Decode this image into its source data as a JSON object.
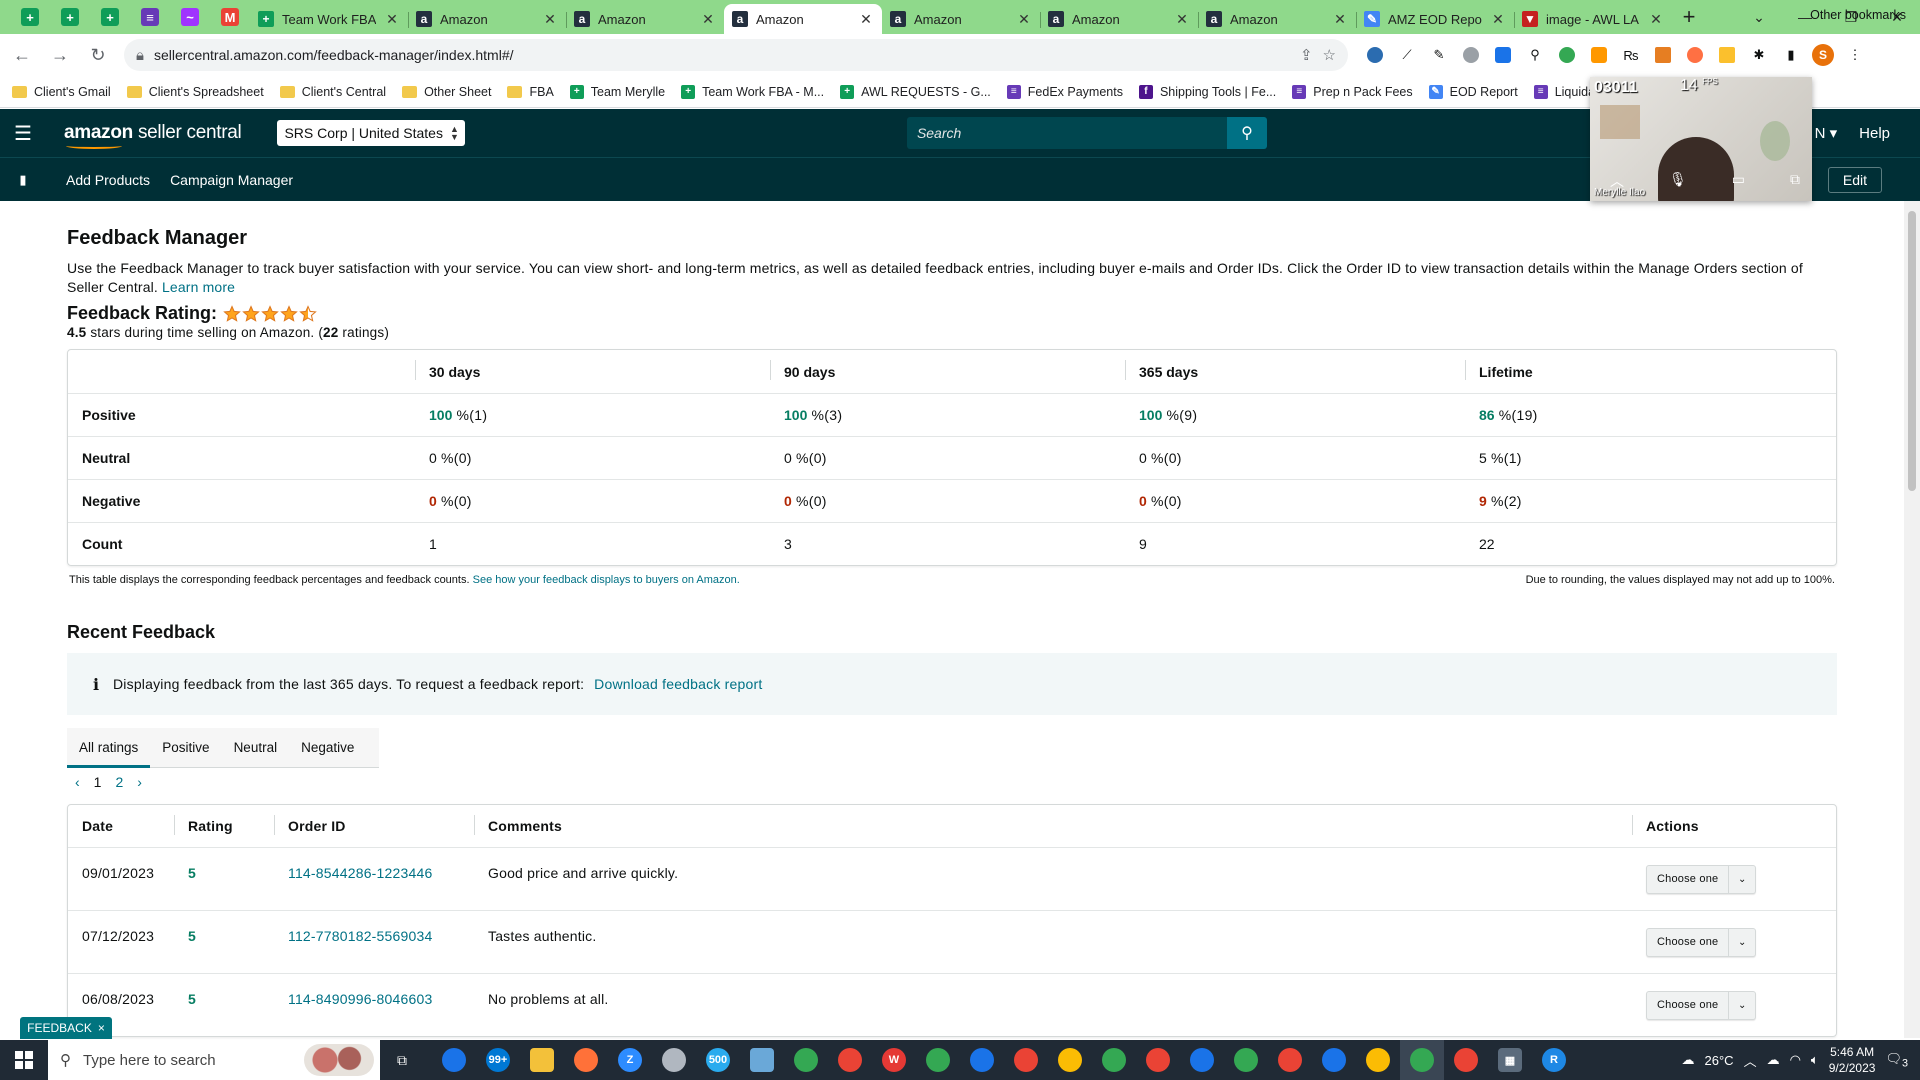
{
  "browser": {
    "pinned_tabs": [
      {
        "icon": "sheets-icon",
        "color": "#0f9d58",
        "glyph": "+"
      },
      {
        "icon": "sheets-icon",
        "color": "#0f9d58",
        "glyph": "+"
      },
      {
        "icon": "sheets-icon",
        "color": "#0f9d58",
        "glyph": "+"
      },
      {
        "icon": "forms-icon",
        "color": "#673ab7",
        "glyph": "≡"
      },
      {
        "icon": "messenger-icon",
        "color": "#a033ff",
        "glyph": "~"
      },
      {
        "icon": "gmail-icon",
        "color": "#ea4335",
        "glyph": "M"
      }
    ],
    "tabs": [
      {
        "title": "Team Work FBA -",
        "icon": "sheets-icon",
        "color": "#0f9d58",
        "glyph": "+",
        "active": false
      },
      {
        "title": "Amazon",
        "icon": "amazon-icon",
        "color": "#232f3e",
        "glyph": "a",
        "active": false
      },
      {
        "title": "Amazon",
        "icon": "amazon-icon",
        "color": "#232f3e",
        "glyph": "a",
        "active": false
      },
      {
        "title": "Amazon",
        "icon": "amazon-icon",
        "color": "#232f3e",
        "glyph": "a",
        "active": true
      },
      {
        "title": "Amazon",
        "icon": "amazon-icon",
        "color": "#232f3e",
        "glyph": "a",
        "active": false
      },
      {
        "title": "Amazon",
        "icon": "amazon-icon",
        "color": "#232f3e",
        "glyph": "a",
        "active": false
      },
      {
        "title": "Amazon",
        "icon": "amazon-icon",
        "color": "#232f3e",
        "glyph": "a",
        "active": false
      },
      {
        "title": "AMZ EOD Report",
        "icon": "pencil-icon",
        "color": "#4285f4",
        "glyph": "✎",
        "active": false
      },
      {
        "title": "image - AWL LAB",
        "icon": "gmail-icon",
        "color": "#c5221f",
        "glyph": "▼",
        "active": false
      }
    ],
    "url": "sellercentral.amazon.com/feedback-manager/index.html#/",
    "profile_initial": "S",
    "bookmarks": [
      {
        "label": "Client's Gmail",
        "type": "folder"
      },
      {
        "label": "Client's Spreadsheet",
        "type": "folder"
      },
      {
        "label": "Client's Central",
        "type": "folder"
      },
      {
        "label": "Other Sheet",
        "type": "folder"
      },
      {
        "label": "FBA",
        "type": "folder"
      },
      {
        "label": "Team Merylle",
        "type": "sheet"
      },
      {
        "label": "Team Work FBA - M...",
        "type": "sheet"
      },
      {
        "label": "AWL REQUESTS - G...",
        "type": "sheet"
      },
      {
        "label": "FedEx Payments",
        "type": "form"
      },
      {
        "label": "Shipping Tools | Fe...",
        "type": "fedex"
      },
      {
        "label": "Prep n Pack Fees",
        "type": "form"
      },
      {
        "label": "EOD Report",
        "type": "pencil"
      },
      {
        "label": "Liquidation Rec",
        "type": "form"
      }
    ],
    "other_bookmarks": "Other bookmarks"
  },
  "header": {
    "logo_brand": "amazon",
    "logo_product": "seller central",
    "account": "SRS Corp | United States",
    "search_placeholder": "Search",
    "lang": "N",
    "help": "Help"
  },
  "subnav": {
    "links": [
      "Add Products",
      "Campaign Manager"
    ],
    "edit": "Edit"
  },
  "video": {
    "label": "03011",
    "fps_value": "14",
    "fps_unit": "FPS",
    "name": "Merylle Ilao"
  },
  "page": {
    "title": "Feedback Manager",
    "intro": "Use the Feedback Manager to track buyer satisfaction with your service. You can view short- and long-term metrics, as well as detailed feedback entries, including buyer e-mails and Order IDs. Click the Order ID to view transaction details within the Manage Orders section of Seller Central.",
    "learn_more": "Learn more",
    "rating_label": "Feedback Rating:",
    "rating_value": 4.5,
    "rating_stars": "4.5",
    "rating_text_mid": "stars during time selling on Amazon. (",
    "rating_count": "22",
    "rating_text_end": "ratings)"
  },
  "metrics": {
    "columns": [
      "",
      "30 days",
      "90 days",
      "365 days",
      "Lifetime"
    ],
    "rows": [
      {
        "label": "Positive",
        "kind": "pos",
        "cells": [
          {
            "v": "100",
            "n": " %(1)"
          },
          {
            "v": "100",
            "n": " %(3)"
          },
          {
            "v": "100",
            "n": " %(9)"
          },
          {
            "v": "86",
            "n": " %(19)"
          }
        ]
      },
      {
        "label": "Neutral",
        "kind": "neu",
        "cells": [
          {
            "v": "0",
            "n": " %(0)"
          },
          {
            "v": "0",
            "n": " %(0)"
          },
          {
            "v": "0",
            "n": " %(0)"
          },
          {
            "v": "5",
            "n": " %(1)"
          }
        ]
      },
      {
        "label": "Negative",
        "kind": "neg",
        "cells": [
          {
            "v": "0",
            "n": " %(0)"
          },
          {
            "v": "0",
            "n": " %(0)"
          },
          {
            "v": "0",
            "n": " %(0)"
          },
          {
            "v": "9",
            "n": " %(2)"
          }
        ]
      },
      {
        "label": "Count",
        "kind": "count",
        "cells": [
          {
            "v": "1",
            "n": ""
          },
          {
            "v": "3",
            "n": ""
          },
          {
            "v": "9",
            "n": ""
          },
          {
            "v": "22",
            "n": ""
          }
        ]
      }
    ],
    "note_left": "This table displays the corresponding feedback percentages and feedback counts.",
    "note_link": "See how your feedback displays to buyers on Amazon.",
    "note_right": "Due to rounding, the values displayed may not add up to 100%."
  },
  "recent": {
    "title": "Recent Feedback",
    "info_text": "Displaying feedback from the last 365 days. To request a feedback report:",
    "info_link": "Download feedback report",
    "tabs": [
      "All ratings",
      "Positive",
      "Neutral",
      "Negative"
    ],
    "active_tab": 0,
    "pages": [
      "1",
      "2"
    ],
    "columns": [
      "Date",
      "Rating",
      "Order ID",
      "Comments",
      "Actions"
    ],
    "rows": [
      {
        "date": "09/01/2023",
        "rating": "5",
        "order": "114-8544286-1223446",
        "comment": "Good price and arrive quickly.",
        "action": "Choose one"
      },
      {
        "date": "07/12/2023",
        "rating": "5",
        "order": "112-7780182-5569034",
        "comment": "Tastes authentic.",
        "action": "Choose one"
      },
      {
        "date": "06/08/2023",
        "rating": "5",
        "order": "114-8490996-8046603",
        "comment": "No problems at all.",
        "action": "Choose one"
      }
    ],
    "feedback_tab": "FEEDBACK"
  },
  "taskbar": {
    "search_placeholder": "Type here to search",
    "icons": [
      {
        "name": "chrome-icon",
        "color": "#1a73e8",
        "glyph": ""
      },
      {
        "name": "mail-icon",
        "color": "#0078d4",
        "glyph": "99+"
      },
      {
        "name": "file-explorer-icon",
        "color": "#f3c13a",
        "glyph": ""
      },
      {
        "name": "firefox-icon",
        "color": "#ff7139",
        "glyph": ""
      },
      {
        "name": "zoom-icon",
        "color": "#2d8cff",
        "glyph": "Z"
      },
      {
        "name": "app-icon",
        "color": "#b0b7c0",
        "glyph": ""
      },
      {
        "name": "telegram-icon",
        "color": "#2aabee",
        "glyph": "500"
      },
      {
        "name": "notepad-icon",
        "color": "#6aa8d8",
        "glyph": ""
      },
      {
        "name": "chrome-icon",
        "color": "#34a853",
        "glyph": ""
      },
      {
        "name": "chrome-icon",
        "color": "#ea4335",
        "glyph": ""
      },
      {
        "name": "wps-icon",
        "color": "#e53935",
        "glyph": "W"
      },
      {
        "name": "chrome-icon",
        "color": "#34a853",
        "glyph": ""
      },
      {
        "name": "chrome-icon",
        "color": "#1a73e8",
        "glyph": ""
      },
      {
        "name": "chrome-icon",
        "color": "#ea4335",
        "glyph": ""
      },
      {
        "name": "chrome-icon",
        "color": "#fbbc04",
        "glyph": ""
      },
      {
        "name": "chrome-icon",
        "color": "#34a853",
        "glyph": ""
      },
      {
        "name": "chrome-icon",
        "color": "#ea4335",
        "glyph": ""
      },
      {
        "name": "chrome-icon",
        "color": "#1a73e8",
        "glyph": ""
      },
      {
        "name": "chrome-icon",
        "color": "#34a853",
        "glyph": ""
      },
      {
        "name": "chrome-icon",
        "color": "#ea4335",
        "glyph": ""
      },
      {
        "name": "chrome-icon",
        "color": "#1a73e8",
        "glyph": ""
      },
      {
        "name": "chrome-icon",
        "color": "#fbbc04",
        "glyph": ""
      },
      {
        "name": "chrome-icon",
        "color": "#34a853",
        "glyph": ""
      },
      {
        "name": "chrome-icon",
        "color": "#ea4335",
        "glyph": ""
      },
      {
        "name": "calculator-icon",
        "color": "#5b6b7c",
        "glyph": "▦"
      },
      {
        "name": "rdp-icon",
        "color": "#1e88e5",
        "glyph": "R"
      }
    ],
    "weather": "26°C",
    "time": "5:46 AM",
    "date": "9/2/2023",
    "notifications": "3"
  },
  "colors": {
    "header_bg": "#002f36",
    "link": "#007185",
    "positive": "#067d62",
    "negative": "#b12704",
    "star": "#ffa41c",
    "tabstrip": "#8fd98b"
  }
}
